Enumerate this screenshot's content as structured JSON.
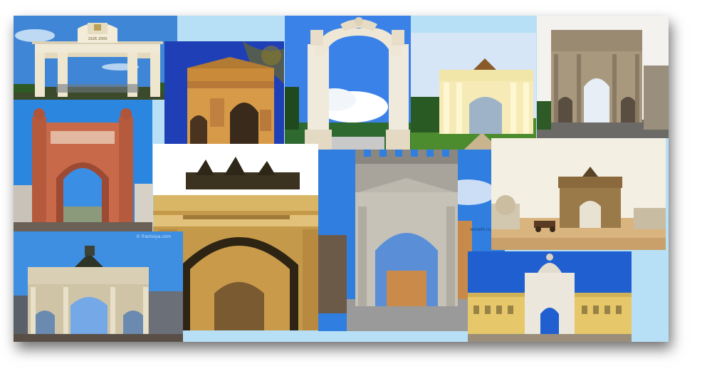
{
  "collage": {
    "background": "#b7e0f6",
    "tiles": [
      {
        "name": "photo-gate-1926",
        "inscription": "1926 2000"
      },
      {
        "name": "photo-arc-de-triomphe"
      },
      {
        "name": "photo-ornate-white-arch"
      },
      {
        "name": "photo-neoclassical-yellow-arch"
      },
      {
        "name": "photo-arch-of-constantine"
      },
      {
        "name": "photo-arc-de-triomf-barcelona"
      },
      {
        "name": "photo-general-staff-arch"
      },
      {
        "name": "photo-arch-of-augustus-rimini"
      },
      {
        "name": "photo-narva-gates-painting"
      },
      {
        "name": "photo-arc-du-carrousel"
      },
      {
        "name": "photo-rua-augusta-arch"
      }
    ],
    "watermarks": {
      "carrousel": "© frantsiya.com",
      "rimini": "wsvekt.ru"
    }
  }
}
